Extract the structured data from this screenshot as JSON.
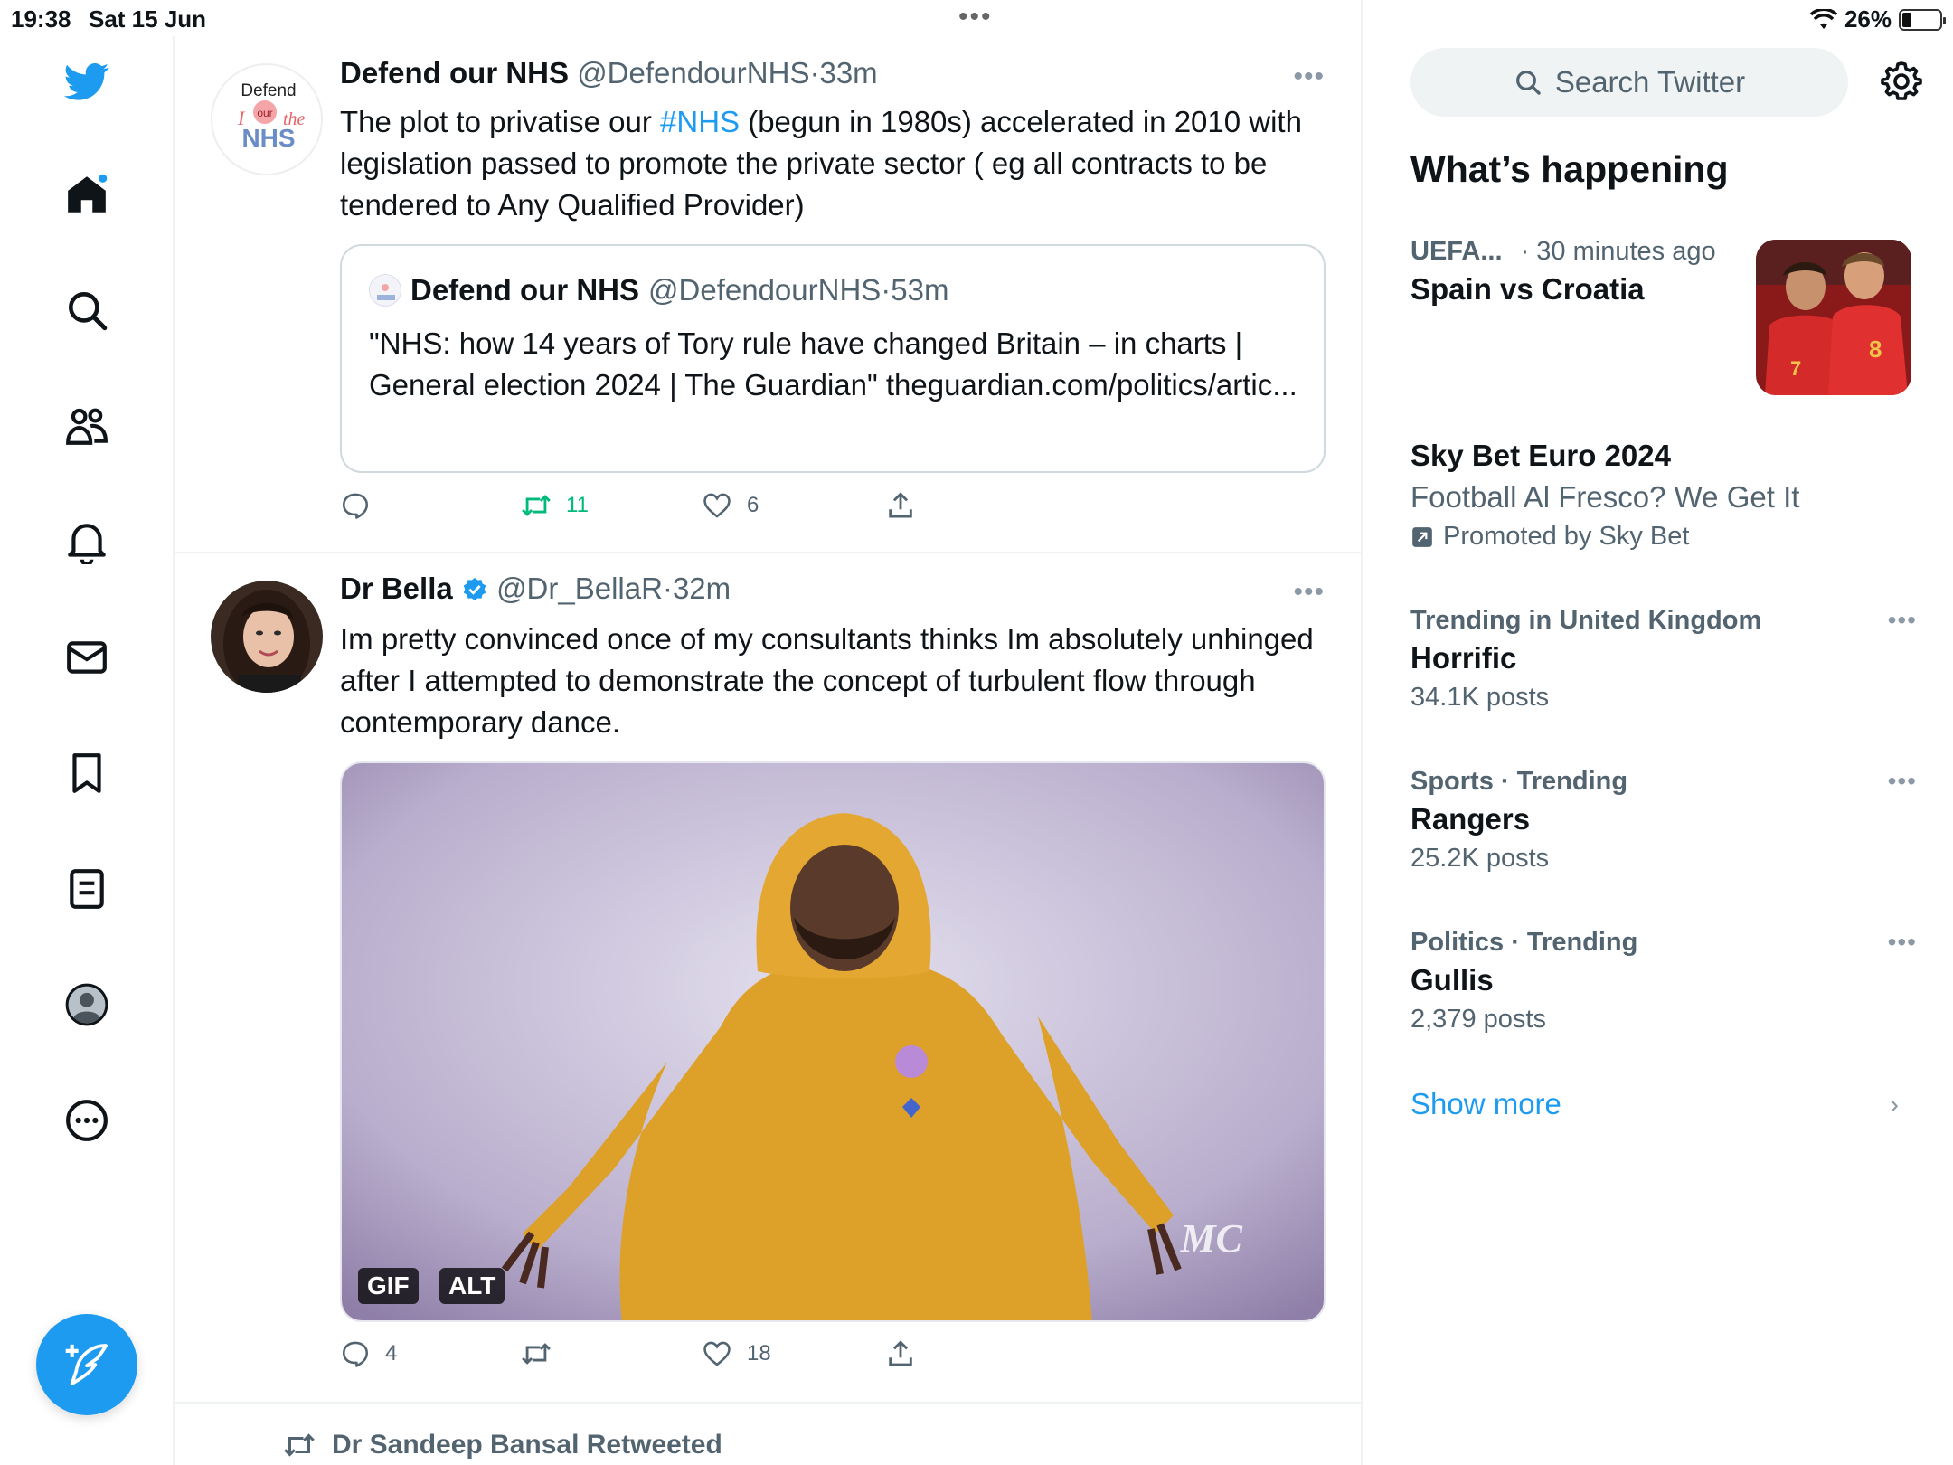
{
  "status_bar": {
    "time": "19:38",
    "date": "Sat 15 Jun",
    "battery": "26%",
    "battery_level": 0.26
  },
  "nav": {
    "items": [
      "twitter-logo",
      "home",
      "search",
      "communities",
      "notifications",
      "messages",
      "bookmarks",
      "lists",
      "profile",
      "more"
    ],
    "compose_label": "Compose"
  },
  "colors": {
    "accent": "#1d9bf0",
    "retweet_active": "#00ba7c",
    "text": "#0f1419",
    "muted": "#536471"
  },
  "tweets": [
    {
      "name": "Defend our NHS",
      "handle": "@DefendourNHS",
      "sep": "·",
      "time": "33m",
      "avatar_text": {
        "top": "Defend",
        "middle": "our",
        "left": "I",
        "right": "the",
        "bottom": "NHS"
      },
      "text_before": "The plot to privatise our ",
      "hashtag": "#NHS",
      "text_after": " (begun in 1980s) accelerated in 2010 with legislation passed to promote the private sector ( eg all contracts to be tendered to Any Qualified Provider)",
      "quote": {
        "name": "Defend our NHS",
        "handle": "@DefendourNHS",
        "sep": "·",
        "time": "53m",
        "text": "\"NHS: how 14 years of Tory rule have changed Britain – in charts | General election 2024 | The Guardian\" theguardian.com/politics/artic..."
      },
      "replies": "",
      "retweets": "11",
      "likes": "6"
    },
    {
      "name": "Dr Bella",
      "handle": "@Dr_BellaR",
      "sep": "·",
      "time": "32m",
      "verified": true,
      "text": "Im pretty convinced once of my consultants thinks Im absolutely unhinged after I attempted to demonstrate the concept of turbulent flow through contemporary dance.",
      "media_badges": [
        "GIF",
        "ALT"
      ],
      "media_watermark": "MC",
      "replies": "4",
      "retweets": "",
      "likes": "18"
    }
  ],
  "retweeted_by": "Dr Sandeep Bansal Retweeted",
  "sidebar": {
    "search_placeholder": "Search Twitter",
    "section_title": "What’s happening",
    "trends": [
      {
        "meta": "UEFA...",
        "meta2": "· 30 minutes ago",
        "topic": "Spain vs Croatia"
      },
      {
        "topic": "Sky Bet Euro 2024",
        "tagline": "Football Al Fresco? We Get It",
        "promoted": "Promoted by Sky Bet"
      },
      {
        "meta": "Trending in United Kingdom",
        "topic": "Horrific",
        "posts": "34.1K posts"
      },
      {
        "meta": "Sports · Trending",
        "topic": "Rangers",
        "posts": "25.2K posts"
      },
      {
        "meta": "Politics · Trending",
        "topic": "Gullis",
        "posts": "2,379 posts"
      }
    ],
    "show_more": "Show more"
  }
}
